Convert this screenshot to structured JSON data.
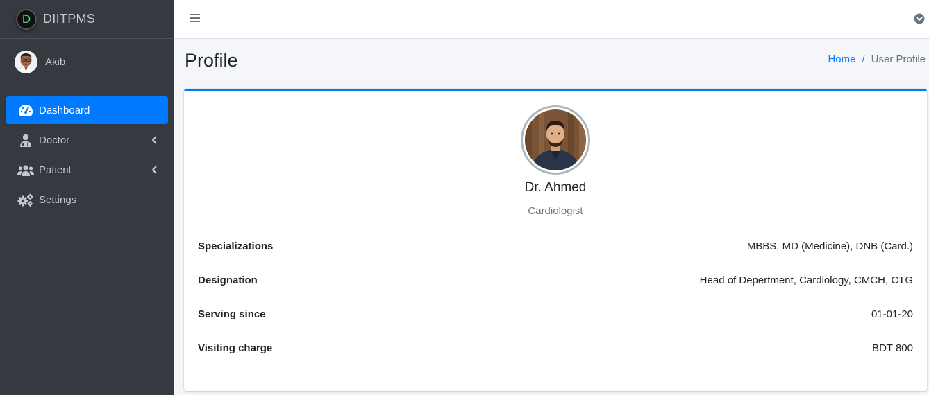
{
  "brand": {
    "letter": "D",
    "name": "DIITPMS"
  },
  "user": {
    "name": "Akib"
  },
  "nav": {
    "items": [
      {
        "label": "Dashboard",
        "icon": "tachometer-icon",
        "active": true
      },
      {
        "label": "Doctor",
        "icon": "user-md-icon",
        "has_submenu": true
      },
      {
        "label": "Patient",
        "icon": "users-icon",
        "has_submenu": true
      },
      {
        "label": "Settings",
        "icon": "cogs-icon"
      }
    ]
  },
  "header": {
    "title": "Profile",
    "breadcrumb": {
      "home": "Home",
      "separator": "/",
      "current": "User Profile"
    }
  },
  "profile": {
    "name": "Dr. Ahmed",
    "role": "Cardiologist",
    "details": [
      {
        "label": "Specializations",
        "value": "MBBS, MD (Medicine), DNB (Card.)"
      },
      {
        "label": "Designation",
        "value": "Head of Depertment, Cardiology, CMCH, CTG"
      },
      {
        "label": "Serving since",
        "value": "01-01-20"
      },
      {
        "label": "Visiting charge",
        "value": "BDT 800"
      }
    ]
  },
  "colors": {
    "accent": "#007bff",
    "sidebar": "#343a40",
    "sidebar_text": "#c2c7d0"
  }
}
